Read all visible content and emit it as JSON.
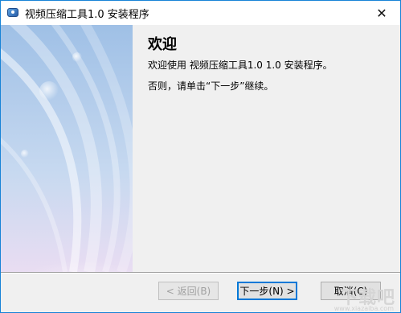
{
  "window": {
    "title": "视频压缩工具1.0 安装程序"
  },
  "titlebar": {
    "close_glyph": "✕"
  },
  "page": {
    "heading": "欢迎",
    "line1": "欢迎使用 视频压缩工具1.0 1.0 安装程序。",
    "line2": "否则，请单击“下一步”继续。"
  },
  "footer": {
    "back_label": "< 返回(B)",
    "next_label": "下一步(N) >",
    "cancel_label": "取消(C)"
  },
  "watermark": {
    "text": "下载吧",
    "sub": "www.xiazaiba.com"
  }
}
